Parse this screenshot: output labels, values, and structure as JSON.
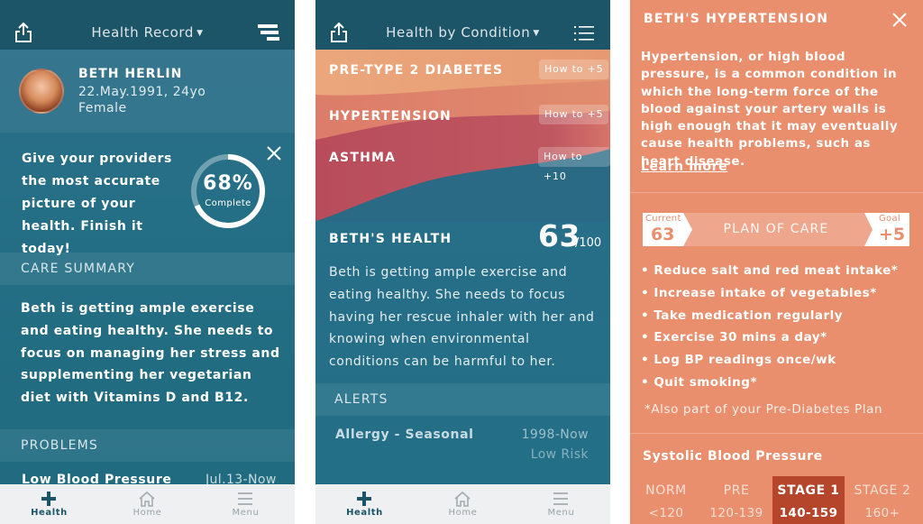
{
  "colors": {
    "teal_dark": "#1c5468",
    "teal": "#256f86",
    "orange_panel": "#e98f6d",
    "stage_active": "#b5452b",
    "band_diabetes": "#e8a07a",
    "band_hypertension": "#d8736b",
    "band_asthma": "#b84d5a"
  },
  "screen1": {
    "title": "Health Record",
    "profile": {
      "name": "BETH HERLIN",
      "dob": "22.May.1991, 24yo",
      "sex": "Female"
    },
    "completion": {
      "prompt": "Give your providers the most accurate picture of your health. Finish it today!",
      "percent_label": "68%",
      "sub_label": "Complete",
      "fraction": 0.68
    },
    "care_summary_header": "CARE SUMMARY",
    "care_summary_text": "Beth is getting ample exercise and eating healthy. She needs to focus on managing her stress and supplementing her vegetarian diet with Vitamins D and B12.",
    "problems_header": "PROBLEMS",
    "problem": {
      "name": "Low Blood Pressure",
      "date": "Jul.13-Now"
    }
  },
  "screen2": {
    "title": "Health by Condition",
    "conditions": [
      {
        "name": "PRE-TYPE 2 DIABETES",
        "action": "How to +5"
      },
      {
        "name": "HYPERTENSION",
        "action": "How to +5"
      },
      {
        "name": "ASTHMA",
        "action": "How to +10"
      }
    ],
    "health_title": "BETH'S HEALTH",
    "score": "63",
    "score_of": "/100",
    "summary": "Beth is getting ample exercise and eating healthy. She needs to focus having her rescue inhaler with her and knowing when environmental conditions can be harmful to her.",
    "alerts_header": "ALERTS",
    "alert": {
      "name": "Allergy - Seasonal",
      "date": "1998-Now",
      "risk": "Low Risk"
    }
  },
  "screen3": {
    "title": "BETH'S HYPERTENSION",
    "description": "Hypertension, or high blood pressure, is a common condition in which the long-term force of the blood against your artery walls is high enough that it may eventually cause health problems, such as heart disease.",
    "learn_more": "Learn more",
    "plan": {
      "current_label": "Current",
      "current_value": "63",
      "title": "PLAN OF CARE",
      "goal_label": "Goal",
      "goal_value": "+5"
    },
    "plan_items": [
      "• Reduce salt and red meat intake*",
      "• Increase intake of vegetables*",
      "• Take medication regularly",
      "• Exercise 30 mins a day*",
      "• Log BP readings once/wk",
      "• Quit smoking*"
    ],
    "footnote": "*Also part of your Pre-Diabetes Plan",
    "bp_title": "Systolic Blood Pressure",
    "stages": [
      {
        "name": "NORM",
        "range": "<120",
        "active": false
      },
      {
        "name": "PRE",
        "range": "120-139",
        "active": false
      },
      {
        "name": "STAGE 1",
        "range": "140-159",
        "active": true
      },
      {
        "name": "STAGE 2",
        "range": "160+",
        "active": false
      }
    ]
  },
  "tabs": [
    {
      "label": "Health",
      "icon": "plus-icon",
      "active": true
    },
    {
      "label": "Home",
      "icon": "home-icon",
      "active": false
    },
    {
      "label": "Menu",
      "icon": "menu-icon",
      "active": false
    }
  ]
}
